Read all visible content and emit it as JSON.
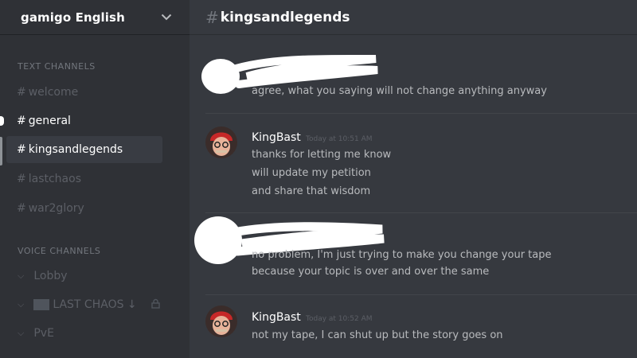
{
  "server": {
    "name": "gamigo English"
  },
  "sidebar": {
    "text_category": "TEXT CHANNELS",
    "text_channels": [
      {
        "label": "welcome"
      },
      {
        "label": "general"
      },
      {
        "label": "kingsandlegends"
      },
      {
        "label": "lastchaos"
      },
      {
        "label": "war2glory"
      }
    ],
    "voice_category": "VOICE CHANNELS",
    "voice_channels": [
      {
        "label": "Lobby"
      },
      {
        "label": "LAST CHAOS ↓"
      },
      {
        "label": "PvE"
      }
    ]
  },
  "channel_header": {
    "hash": "#",
    "name": "kingsandlegends"
  },
  "messages": [
    {
      "lines": [
        "agree, what you saying will not change anything anyway"
      ]
    },
    {
      "username": "KingBast",
      "timestamp": "Today at 10:51 AM",
      "lines": [
        "thanks for letting me know",
        "will update my petition",
        "and share that wisdom"
      ]
    },
    {
      "lines": [
        "no problem, I'm just trying to make you change your tape",
        "because your topic is over and over the same"
      ]
    },
    {
      "username": "KingBast",
      "timestamp": "Today at 10:52 AM",
      "lines": [
        "not my tape, I can shut up but the story goes on"
      ]
    }
  ]
}
